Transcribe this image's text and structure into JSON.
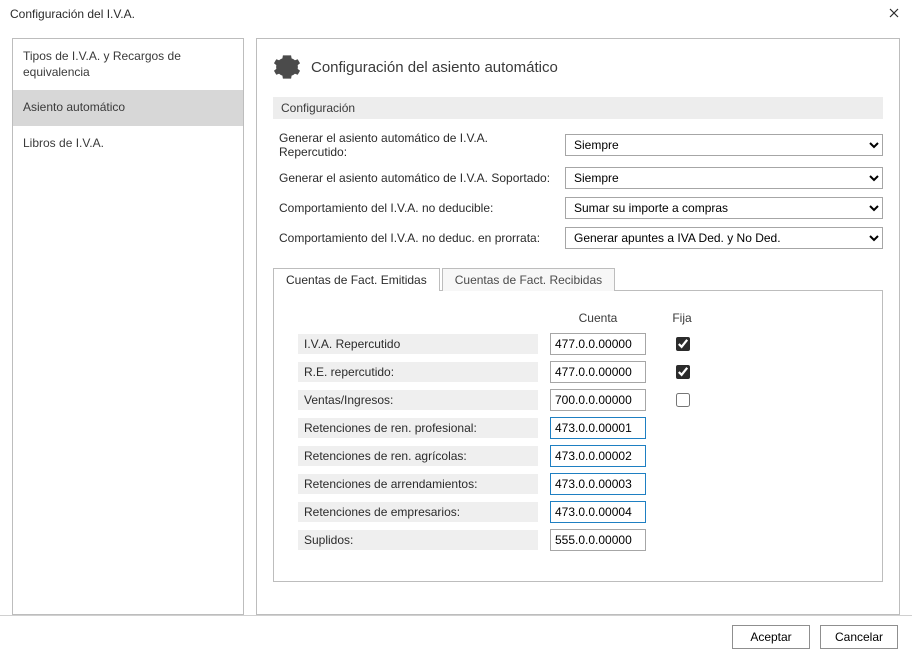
{
  "window": {
    "title": "Configuración del I.V.A."
  },
  "sidebar": {
    "items": [
      {
        "label": "Tipos de I.V.A. y Recargos de equivalencia",
        "selected": false
      },
      {
        "label": "Asiento automático",
        "selected": true
      },
      {
        "label": "Libros de I.V.A.",
        "selected": false
      }
    ]
  },
  "header": {
    "title": "Configuración del asiento automático"
  },
  "section": {
    "title": "Configuración"
  },
  "form": {
    "rows": [
      {
        "label": "Generar el asiento automático de I.V.A. Repercutido:",
        "value": "Siempre"
      },
      {
        "label": "Generar el asiento automático de I.V.A. Soportado:",
        "value": "Siempre"
      },
      {
        "label": "Comportamiento del I.V.A. no deducible:",
        "value": "Sumar su importe a compras"
      },
      {
        "label": "Comportamiento del I.V.A. no deduc. en prorrata:",
        "value": "Generar apuntes a IVA Ded. y No Ded."
      }
    ]
  },
  "tabs": {
    "items": [
      {
        "label": "Cuentas de Fact. Emitidas",
        "active": true
      },
      {
        "label": "Cuentas de Fact. Recibidas",
        "active": false
      }
    ]
  },
  "table": {
    "headers": {
      "cuenta": "Cuenta",
      "fija": "Fija"
    },
    "rows": [
      {
        "label": "I.V.A. Repercutido",
        "cuenta": "477.0.0.00000",
        "fija": true,
        "highlight": false
      },
      {
        "label": "R.E. repercutido:",
        "cuenta": "477.0.0.00000",
        "fija": true,
        "highlight": false
      },
      {
        "label": "Ventas/Ingresos:",
        "cuenta": "700.0.0.00000",
        "fija": false,
        "highlight": false
      },
      {
        "label": "Retenciones de ren. profesional:",
        "cuenta": "473.0.0.00001",
        "fija": null,
        "highlight": true
      },
      {
        "label": "Retenciones de ren. agrícolas:",
        "cuenta": "473.0.0.00002",
        "fija": null,
        "highlight": true
      },
      {
        "label": "Retenciones de arrendamientos:",
        "cuenta": "473.0.0.00003",
        "fija": null,
        "highlight": true
      },
      {
        "label": "Retenciones de empresarios:",
        "cuenta": "473.0.0.00004",
        "fija": null,
        "highlight": true
      },
      {
        "label": "Suplidos:",
        "cuenta": "555.0.0.00000",
        "fija": null,
        "highlight": false
      }
    ]
  },
  "buttons": {
    "accept": "Aceptar",
    "cancel": "Cancelar"
  }
}
